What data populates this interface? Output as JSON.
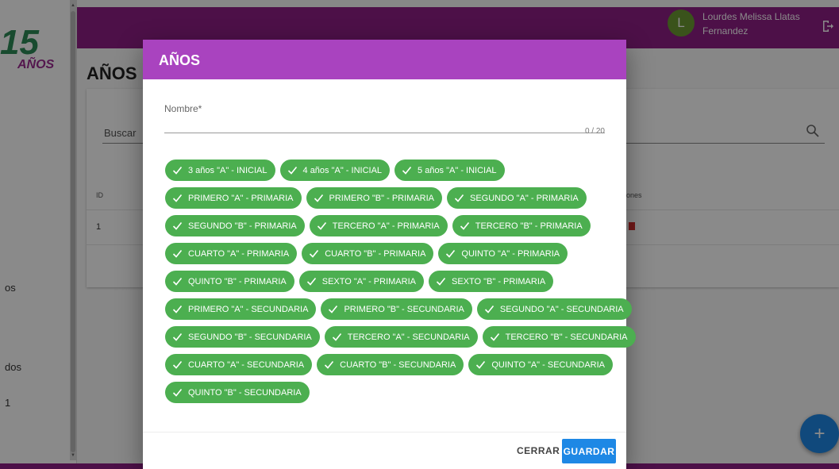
{
  "sidebar": {
    "logo_text": "15 AÑOS",
    "fragments": [
      "os",
      "dos",
      "1"
    ]
  },
  "topbar": {
    "avatar_letter": "L",
    "user_name": "Lourdes Melissa Llatas Fernandez"
  },
  "page": {
    "title": "AÑOS",
    "search_label": "Buscar",
    "columns": {
      "id": "ID",
      "actions": "ones"
    },
    "rows": [
      {
        "id": "1"
      }
    ]
  },
  "fab_label": "+",
  "dialog": {
    "title": "AÑOS",
    "name_label": "Nombre*",
    "name_value": "",
    "name_counter": "0 / 20",
    "chips": [
      [
        "3 años \"A\" - INICIAL",
        "4 años \"A\" - INICIAL",
        "5 años \"A\" - INICIAL"
      ],
      [
        "PRIMERO \"A\" - PRIMARIA",
        "PRIMERO \"B\" - PRIMARIA",
        "SEGUNDO \"A\" - PRIMARIA"
      ],
      [
        "SEGUNDO \"B\" - PRIMARIA",
        "TERCERO \"A\" - PRIMARIA",
        "TERCERO \"B\" - PRIMARIA"
      ],
      [
        "CUARTO \"A\" - PRIMARIA",
        "CUARTO \"B\" - PRIMARIA",
        "QUINTO \"A\" - PRIMARIA"
      ],
      [
        "QUINTO \"B\" - PRIMARIA",
        "SEXTO \"A\" - PRIMARIA",
        "SEXTO \"B\" - PRIMARIA"
      ],
      [
        "PRIMERO \"A\" - SECUNDARIA",
        "PRIMERO \"B\" - SECUNDARIA",
        "SEGUNDO \"A\" - SECUNDARIA"
      ],
      [
        "SEGUNDO \"B\" - SECUNDARIA",
        "TERCERO \"A\" - SECUNDARIA",
        "TERCERO \"B\" - SECUNDARIA"
      ],
      [
        "CUARTO \"A\" - SECUNDARIA",
        "CUARTO \"B\" - SECUNDARIA",
        "QUINTO \"A\" - SECUNDARIA"
      ],
      [
        "QUINTO \"B\" - SECUNDARIA"
      ]
    ],
    "close_label": "CERRAR",
    "save_label": "GUARDAR"
  },
  "colors": {
    "topbar": "#8e1e86",
    "dialog_header": "#a943bf",
    "chip": "#4caf50",
    "primary_button": "#1e88e5",
    "avatar": "#6b9a33",
    "delete": "#d32f2f"
  }
}
